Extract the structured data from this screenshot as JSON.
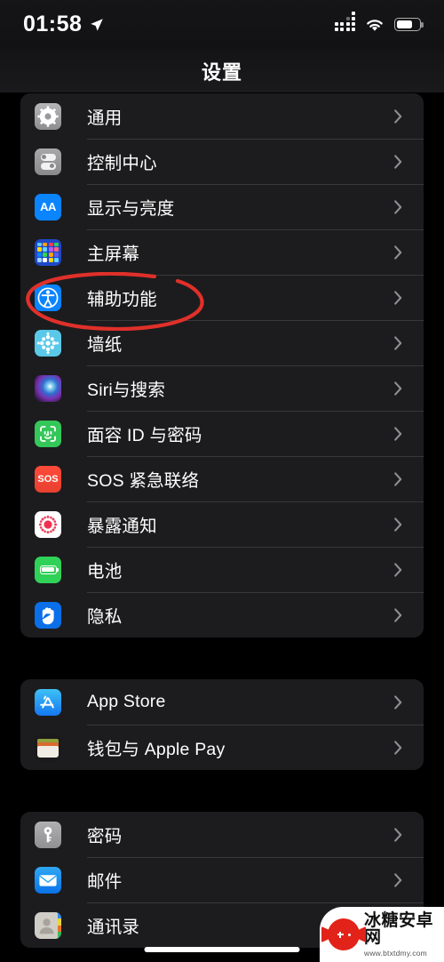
{
  "status_bar": {
    "time": "01:58",
    "location_icon": "location-arrow-icon",
    "signal_icon": "cellular-signal-icon",
    "wifi_icon": "wifi-icon",
    "battery_icon": "battery-icon",
    "battery_level_percent": 70
  },
  "nav_bar": {
    "title": "设置"
  },
  "colors": {
    "page_background": "#000000",
    "card_background": "#1C1C1E",
    "separator": "#38383A",
    "label_text": "#FFFFFF",
    "chevron": "#8E8E93",
    "annotation_red": "#E0302A",
    "accent_blue": "#0A84FF"
  },
  "annotation": {
    "shape": "ellipse",
    "color": "#E0302A",
    "target_label": "辅助功能"
  },
  "groups": [
    {
      "rows": [
        {
          "label": "通用",
          "icon": "gear-icon"
        },
        {
          "label": "控制中心",
          "icon": "control-center-icon"
        },
        {
          "label": "显示与亮度",
          "icon": "display-brightness-icon",
          "icon_text": "AA"
        },
        {
          "label": "主屏幕",
          "icon": "home-screen-icon"
        },
        {
          "label": "辅助功能",
          "icon": "accessibility-icon",
          "highlighted": true
        },
        {
          "label": "墙纸",
          "icon": "wallpaper-icon"
        },
        {
          "label": "Siri与搜索",
          "icon": "siri-icon"
        },
        {
          "label": "面容 ID 与密码",
          "icon": "face-id-icon"
        },
        {
          "label": "SOS 紧急联络",
          "icon": "sos-icon",
          "icon_text": "SOS"
        },
        {
          "label": "暴露通知",
          "icon": "exposure-notification-icon"
        },
        {
          "label": "电池",
          "icon": "battery-settings-icon"
        },
        {
          "label": "隐私",
          "icon": "privacy-hand-icon"
        }
      ]
    },
    {
      "rows": [
        {
          "label": "App Store",
          "icon": "app-store-icon"
        },
        {
          "label": "钱包与 Apple Pay",
          "icon": "wallet-icon"
        }
      ]
    },
    {
      "rows": [
        {
          "label": "密码",
          "icon": "passwords-key-icon"
        },
        {
          "label": "邮件",
          "icon": "mail-icon"
        },
        {
          "label": "通讯录",
          "icon": "contacts-icon"
        }
      ]
    }
  ],
  "watermark": {
    "title": "冰糖安卓网",
    "url": "www.btxtdmy.com",
    "logo_icon": "gamepad-candy-logo-icon"
  }
}
